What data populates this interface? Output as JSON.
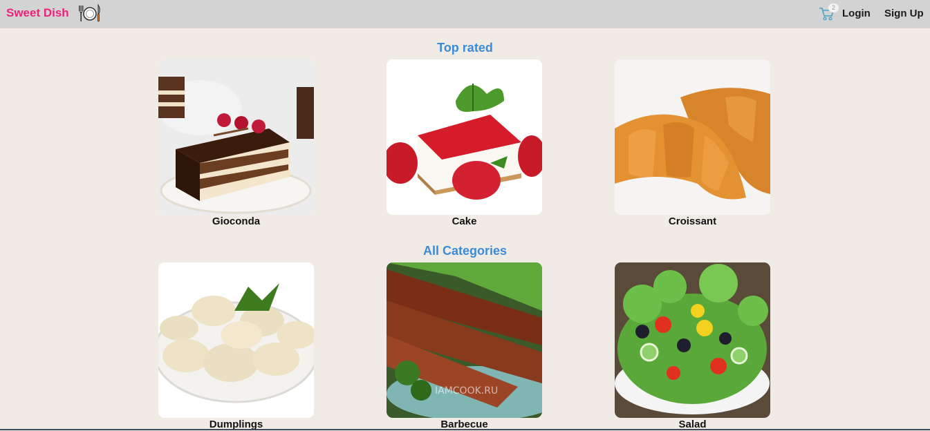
{
  "header": {
    "brand": "Sweet Dish",
    "brand_icon": "plate-cutlery-icon",
    "cart_icon": "shopping-cart-icon",
    "cart_count": "2",
    "login": "Login",
    "signup": "Sign Up"
  },
  "top_rated": {
    "title": "Top rated",
    "items": [
      {
        "label": "Gioconda",
        "image": "chocolate-layer-cake-image"
      },
      {
        "label": "Cake",
        "image": "strawberry-cheesecake-image"
      },
      {
        "label": "Croissant",
        "image": "croissants-image"
      }
    ]
  },
  "categories": {
    "title": "All Categories",
    "items": [
      {
        "label": "Dumplings",
        "image": "dumplings-image"
      },
      {
        "label": "Barbecue",
        "image": "barbecue-skewers-image",
        "watermark": "IAMCOOK.RU"
      },
      {
        "label": "Salad",
        "image": "greek-salad-image"
      }
    ]
  },
  "colors": {
    "brand": "#e8237a",
    "section_title": "#3b8bd9",
    "header_bg": "#d3d3d3",
    "page_bg": "#f1ebe6"
  }
}
